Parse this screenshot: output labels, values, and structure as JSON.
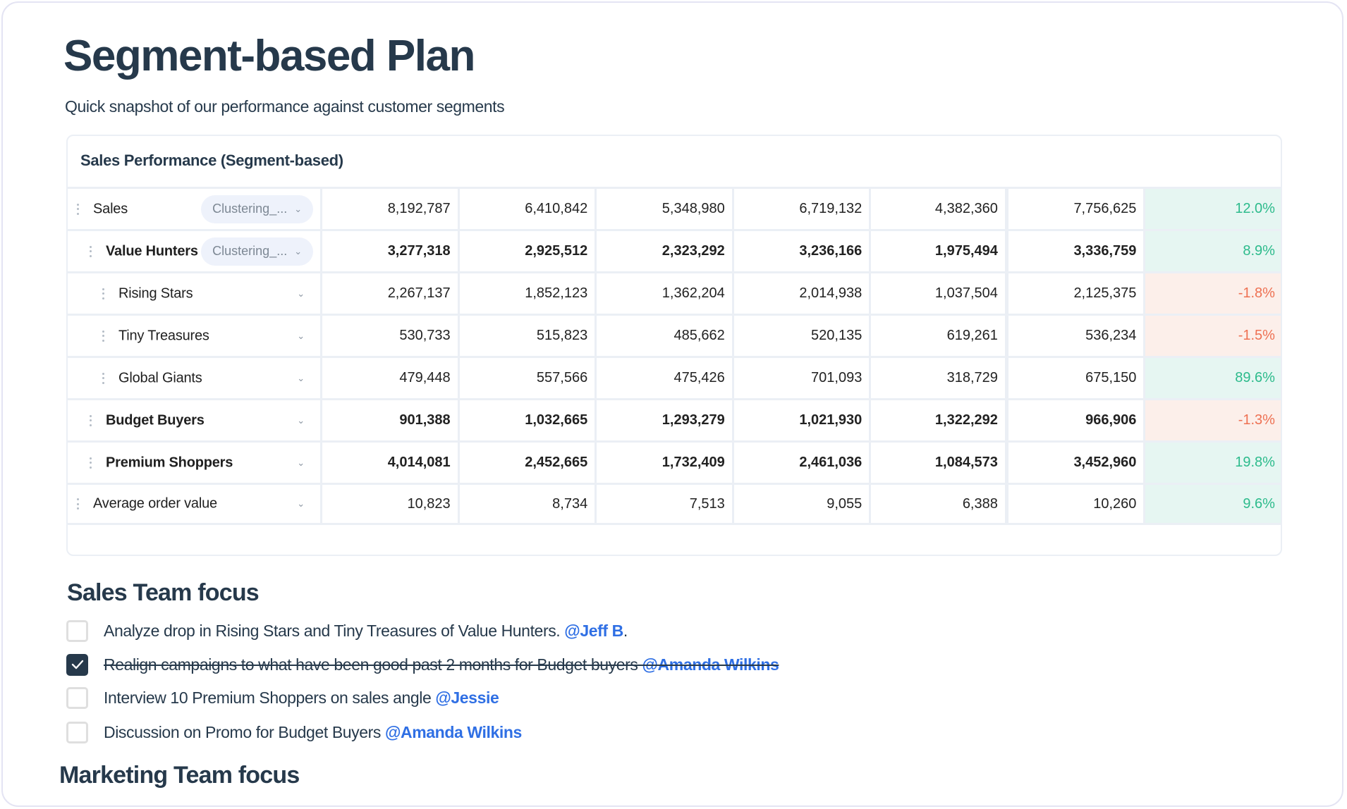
{
  "page": {
    "title": "Segment-based Plan",
    "subtitle": "Quick snapshot of our performance against customer segments"
  },
  "table": {
    "title": "Sales Performance (Segment-based)",
    "rows": [
      {
        "label": "Sales",
        "indent": 0,
        "bold": false,
        "dropdown": "Clustering_...",
        "values": [
          "8,192,787",
          "6,410,842",
          "5,348,980",
          "6,719,132",
          "4,382,360",
          "7,756,625"
        ],
        "change": "12.0%",
        "trend": "positive"
      },
      {
        "label": "Value Hunters",
        "indent": 1,
        "bold": true,
        "dropdown": "Clustering_...",
        "values": [
          "3,277,318",
          "2,925,512",
          "2,323,292",
          "3,236,166",
          "1,975,494",
          "3,336,759"
        ],
        "change": "8.9%",
        "trend": "positive"
      },
      {
        "label": "Rising Stars",
        "indent": 2,
        "bold": false,
        "dropdown": null,
        "values": [
          "2,267,137",
          "1,852,123",
          "1,362,204",
          "2,014,938",
          "1,037,504",
          "2,125,375"
        ],
        "change": "-1.8%",
        "trend": "negative"
      },
      {
        "label": "Tiny Treasures",
        "indent": 2,
        "bold": false,
        "dropdown": null,
        "values": [
          "530,733",
          "515,823",
          "485,662",
          "520,135",
          "619,261",
          "536,234"
        ],
        "change": "-1.5%",
        "trend": "negative"
      },
      {
        "label": "Global Giants",
        "indent": 2,
        "bold": false,
        "dropdown": null,
        "values": [
          "479,448",
          "557,566",
          "475,426",
          "701,093",
          "318,729",
          "675,150"
        ],
        "change": "89.6%",
        "trend": "positive"
      },
      {
        "label": "Budget Buyers",
        "indent": 1,
        "bold": true,
        "dropdown": null,
        "values": [
          "901,388",
          "1,032,665",
          "1,293,279",
          "1,021,930",
          "1,322,292",
          "966,906"
        ],
        "change": "-1.3%",
        "trend": "negative"
      },
      {
        "label": "Premium Shoppers",
        "indent": 1,
        "bold": true,
        "dropdown": null,
        "values": [
          "4,014,081",
          "2,452,665",
          "1,732,409",
          "2,461,036",
          "1,084,573",
          "3,452,960"
        ],
        "change": "19.8%",
        "trend": "positive"
      },
      {
        "label": "Average order value",
        "indent": 0,
        "bold": false,
        "dropdown": null,
        "values": [
          "10,823",
          "8,734",
          "7,513",
          "9,055",
          "6,388",
          "10,260"
        ],
        "change": "9.6%",
        "trend": "positive"
      }
    ]
  },
  "sales_focus": {
    "title": "Sales Team focus",
    "items": [
      {
        "text": "Analyze drop in Rising Stars and Tiny Treasures of Value Hunters. ",
        "mention": "@Jeff B",
        "suffix": ".",
        "checked": false
      },
      {
        "text": "Realign campaigns to what have been good past 2 months for Budget buyers ",
        "mention": "@Amanda Wilkins",
        "suffix": "",
        "checked": true
      },
      {
        "text": "Interview 10 Premium Shoppers on sales angle ",
        "mention": "@Jessie",
        "suffix": "",
        "checked": false
      },
      {
        "text": "Discussion on Promo for Budget Buyers ",
        "mention": "@Amanda Wilkins",
        "suffix": "",
        "checked": false
      }
    ]
  },
  "marketing_focus": {
    "title": "Marketing Team focus"
  },
  "colors": {
    "positive_text": "#2dbb8c",
    "positive_bg": "#e6f6f2",
    "negative_text": "#ee7153",
    "negative_bg": "#fcefea",
    "mention": "#2f6fe4",
    "heading": "#26394b"
  }
}
